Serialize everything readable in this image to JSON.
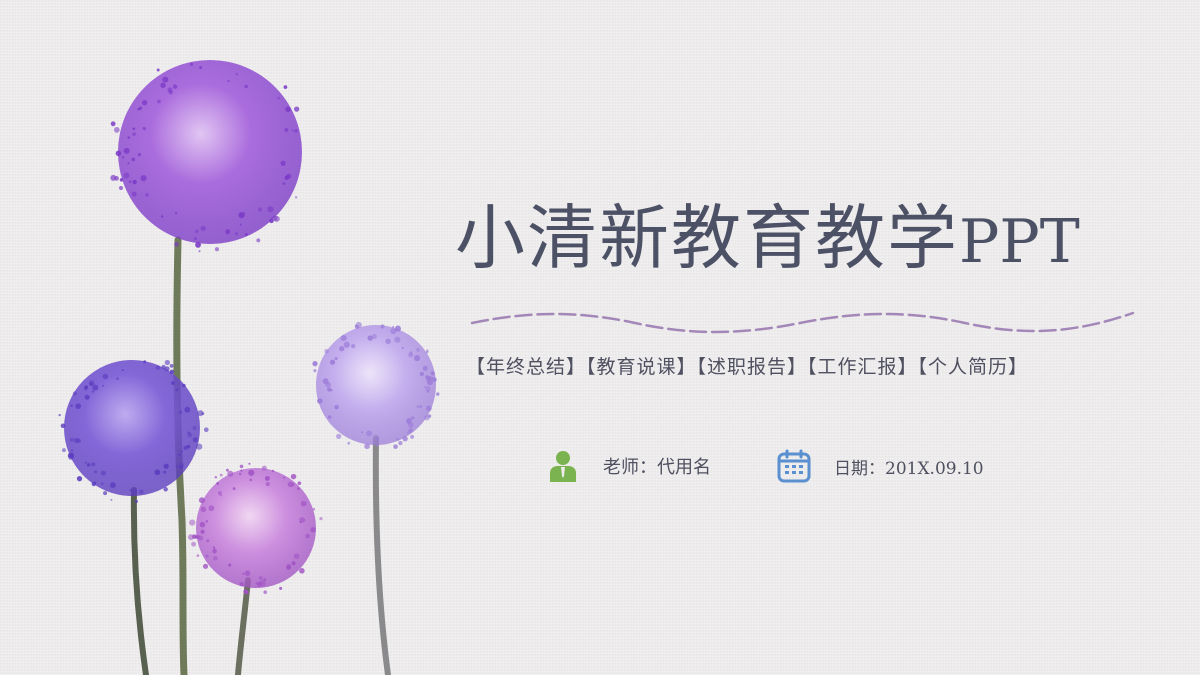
{
  "slide": {
    "title_cn": "小清新教育教学",
    "title_latin": "PPT",
    "tags": "【年终总结】【教育说课】【述职报告】【工作汇报】【个人简历】",
    "teacher_text": "老师：代用名",
    "date_text": "日期：201X.09.10",
    "teacher_icon": "person-icon",
    "date_icon": "calendar-icon"
  },
  "colors": {
    "title": "#4c5166",
    "wave": "#a487b9",
    "person_icon": "#7ab34f",
    "calendar_icon": "#5a8fd0",
    "flower_purple": "#8d4fd1",
    "flower_lilac": "#b79be8",
    "flower_pink": "#c46ad8"
  }
}
